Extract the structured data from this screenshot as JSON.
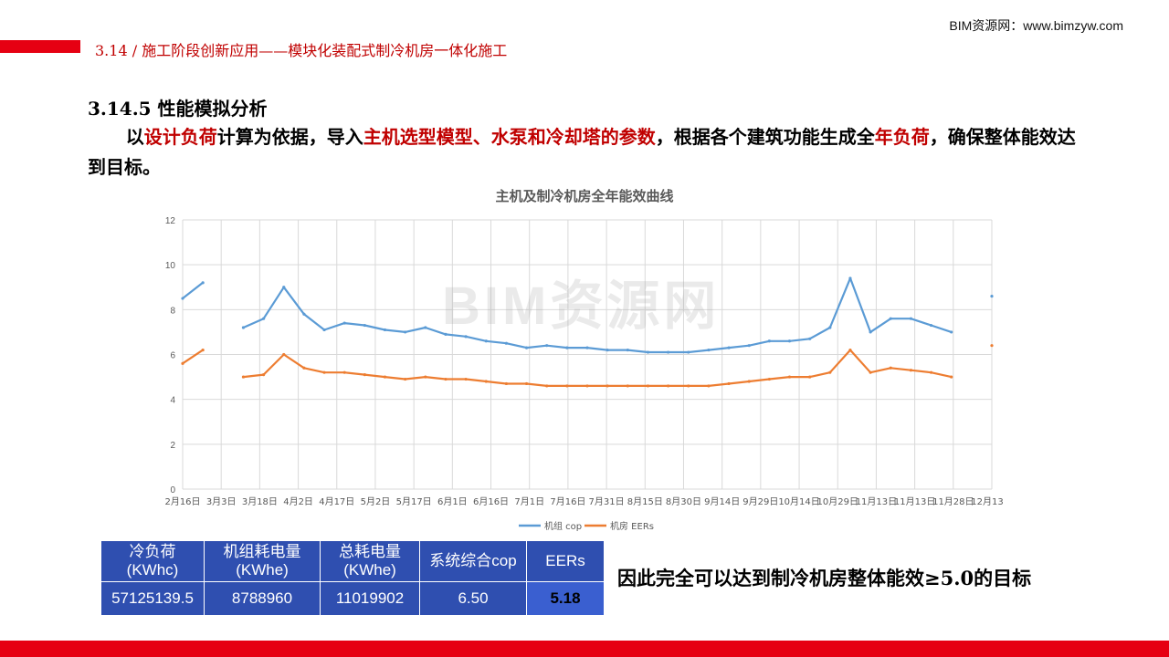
{
  "header": {
    "title": "3.14 / 施工阶段创新应用——模块化装配式制冷机房一体化施工",
    "site": "BIM资源网：www.bimzyw.com"
  },
  "watermark": "BIM资源网",
  "section": {
    "title": "3.14.5 性能模拟分析",
    "para": [
      {
        "t": "以",
        "red": false
      },
      {
        "t": "设计负荷",
        "red": true
      },
      {
        "t": "计算为依据，导入",
        "red": false
      },
      {
        "t": "主机选型模型、水泵和冷却塔的参数",
        "red": true
      },
      {
        "t": "，根据各个建筑功能生成全",
        "red": false
      },
      {
        "t": "年负荷",
        "red": true
      },
      {
        "t": "，确保整体能效达到目标。",
        "red": false
      }
    ]
  },
  "colors": {
    "accent_red": "#e60012",
    "title_red": "#c00000",
    "series_blue": "#5b9bd5",
    "series_orange": "#ed7d31",
    "table_blue": "#2f4fb0"
  },
  "chart_data": {
    "type": "line",
    "title": "主机及制冷机房全年能效曲线",
    "xlabel": "",
    "ylabel": "",
    "ylim": [
      0,
      12
    ],
    "yticks": [
      0,
      2,
      4,
      6,
      8,
      10,
      12
    ],
    "grid": true,
    "legend": "bottom",
    "x_ticks": [
      "2月16日",
      "3月3日",
      "3月18日",
      "4月2日",
      "4月17日",
      "5月2日",
      "5月17日",
      "6月1日",
      "6月16日",
      "7月1日",
      "7月16日",
      "7月31日",
      "8月15日",
      "8月30日",
      "9月14日",
      "9月29日",
      "10月14日",
      "10月29日",
      "11月13日",
      "11月13日",
      "11月28日",
      "12月13日"
    ],
    "series": [
      {
        "name": "机组 cop",
        "values": [
          8.5,
          9.2,
          null,
          7.2,
          7.6,
          9.0,
          7.8,
          7.1,
          7.4,
          7.3,
          7.1,
          7.0,
          7.2,
          6.9,
          6.8,
          6.6,
          6.5,
          6.3,
          6.4,
          6.3,
          6.3,
          6.2,
          6.2,
          6.1,
          6.1,
          6.1,
          6.2,
          6.3,
          6.4,
          6.6,
          6.6,
          6.7,
          7.2,
          9.4,
          7.0,
          7.6,
          7.6,
          7.3,
          7.0,
          null,
          8.6
        ]
      },
      {
        "name": "机房 EERs",
        "values": [
          5.6,
          6.2,
          null,
          5.0,
          5.1,
          6.0,
          5.4,
          5.2,
          5.2,
          5.1,
          5.0,
          4.9,
          5.0,
          4.9,
          4.9,
          4.8,
          4.7,
          4.7,
          4.6,
          4.6,
          4.6,
          4.6,
          4.6,
          4.6,
          4.6,
          4.6,
          4.6,
          4.7,
          4.8,
          4.9,
          5.0,
          5.0,
          5.2,
          6.2,
          5.2,
          5.4,
          5.3,
          5.2,
          5.0,
          null,
          6.4
        ]
      }
    ]
  },
  "table": {
    "headers": [
      [
        "冷负荷",
        "(KWhc)"
      ],
      [
        "机组耗电量",
        "(KWhe)"
      ],
      [
        "总耗电量",
        "(KWhe)"
      ],
      [
        "系统综合cop",
        ""
      ],
      [
        "EERs",
        ""
      ]
    ],
    "values": [
      "57125139.5",
      "8788960",
      "11019902",
      "6.50",
      "5.18"
    ]
  },
  "conclusion": "因此完全可以达到制冷机房整体能效≥5.0的目标"
}
